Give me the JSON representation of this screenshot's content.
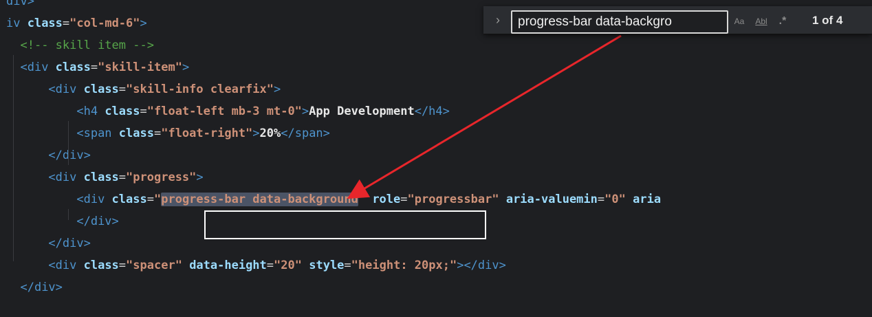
{
  "editor": {
    "lines": [
      {
        "indent": "",
        "parts": [
          [
            "tag",
            "div>"
          ]
        ]
      },
      {
        "indent": "",
        "parts": [
          [
            "tag",
            "iv "
          ],
          [
            "attr",
            "class"
          ],
          [
            "eq",
            "="
          ],
          [
            "str",
            "\"col-md-6\""
          ],
          [
            "tag",
            ">"
          ]
        ]
      },
      {
        "indent": "  ",
        "parts": [
          [
            "cmt",
            "<!-- skill item -->"
          ]
        ]
      },
      {
        "indent": "  ",
        "parts": [
          [
            "tag",
            "<div "
          ],
          [
            "attr",
            "class"
          ],
          [
            "eq",
            "="
          ],
          [
            "str",
            "\"skill-item\""
          ],
          [
            "tag",
            ">"
          ]
        ]
      },
      {
        "indent": "      ",
        "parts": [
          [
            "tag",
            "<div "
          ],
          [
            "attr",
            "class"
          ],
          [
            "eq",
            "="
          ],
          [
            "str",
            "\"skill-info clearfix\""
          ],
          [
            "tag",
            ">"
          ]
        ]
      },
      {
        "indent": "          ",
        "parts": [
          [
            "tag",
            "<h4 "
          ],
          [
            "attr",
            "class"
          ],
          [
            "eq",
            "="
          ],
          [
            "str",
            "\"float-left mb-3 mt-0\""
          ],
          [
            "tag",
            ">"
          ],
          [
            "txt",
            "App Development"
          ],
          [
            "tag",
            "</h4>"
          ]
        ]
      },
      {
        "indent": "          ",
        "parts": [
          [
            "tag",
            "<span "
          ],
          [
            "attr",
            "class"
          ],
          [
            "eq",
            "="
          ],
          [
            "str",
            "\"float-right\""
          ],
          [
            "tag",
            ">"
          ],
          [
            "txt",
            "20%"
          ],
          [
            "tag",
            "</span>"
          ]
        ]
      },
      {
        "indent": "      ",
        "parts": [
          [
            "tag",
            "</div>"
          ]
        ]
      },
      {
        "indent": "      ",
        "parts": [
          [
            "tag",
            "<div "
          ],
          [
            "attr",
            "class"
          ],
          [
            "eq",
            "="
          ],
          [
            "str",
            "\"progress\""
          ],
          [
            "tag",
            ">"
          ]
        ]
      },
      {
        "indent": "          ",
        "parts": [
          [
            "tag",
            "<div "
          ],
          [
            "attr",
            "class"
          ],
          [
            "eq",
            "="
          ],
          [
            "str",
            "\""
          ],
          [
            "hl",
            "progress-bar data-background"
          ],
          [
            "str",
            "\""
          ],
          [
            "eq",
            " "
          ],
          [
            "attr",
            "role"
          ],
          [
            "eq",
            "="
          ],
          [
            "str",
            "\"progressbar\""
          ],
          [
            "eq",
            " "
          ],
          [
            "attr",
            "aria-valuemin"
          ],
          [
            "eq",
            "="
          ],
          [
            "str",
            "\"0\""
          ],
          [
            "eq",
            " "
          ],
          [
            "attr",
            "aria"
          ]
        ]
      },
      {
        "indent": "          ",
        "parts": [
          [
            "tag",
            "</div>"
          ]
        ]
      },
      {
        "indent": "      ",
        "parts": [
          [
            "tag",
            "</div>"
          ]
        ]
      },
      {
        "indent": "      ",
        "parts": [
          [
            "tag",
            "<div "
          ],
          [
            "attr",
            "class"
          ],
          [
            "eq",
            "="
          ],
          [
            "str",
            "\"spacer\""
          ],
          [
            "eq",
            " "
          ],
          [
            "attr",
            "data-height"
          ],
          [
            "eq",
            "="
          ],
          [
            "str",
            "\"20\""
          ],
          [
            "eq",
            " "
          ],
          [
            "attr",
            "style"
          ],
          [
            "eq",
            "="
          ],
          [
            "str",
            "\"height: 20px;\""
          ],
          [
            "tag",
            "></div>"
          ]
        ]
      },
      {
        "indent": "  ",
        "parts": [
          [
            "tag",
            "</div>"
          ]
        ]
      }
    ]
  },
  "find_widget": {
    "query": "progress-bar data-backgro",
    "match_case_label": "Aa",
    "whole_word_label": "Abl",
    "regex_label": ".*",
    "result_count": "1 of 4"
  },
  "colors": {
    "annotation_arrow": "#e8262b",
    "annotation_box": "#ffffff"
  }
}
